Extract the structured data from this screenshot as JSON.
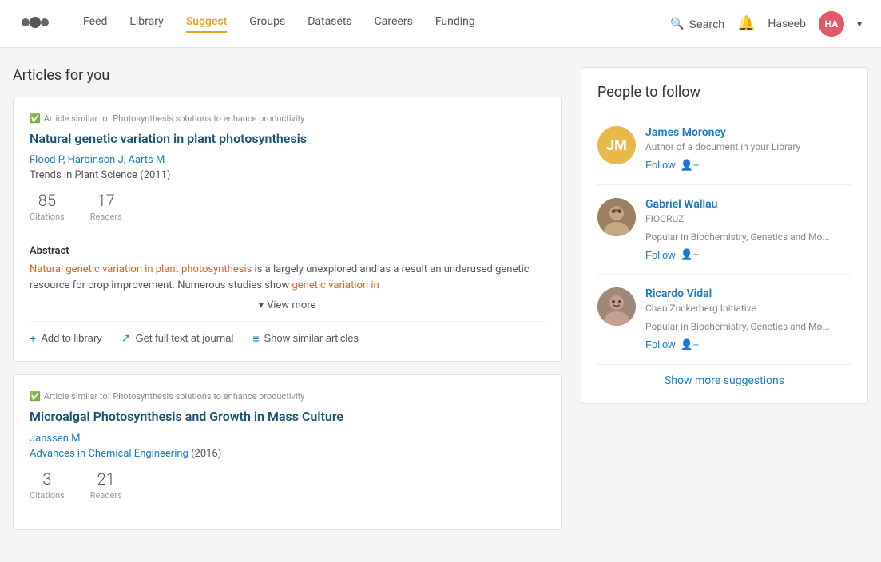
{
  "header": {
    "logo_alt": "Mendeley logo",
    "nav": [
      {
        "label": "Feed",
        "active": false
      },
      {
        "label": "Library",
        "active": false
      },
      {
        "label": "Suggest",
        "active": true
      },
      {
        "label": "Groups",
        "active": false
      },
      {
        "label": "Datasets",
        "active": false
      },
      {
        "label": "Careers",
        "active": false
      },
      {
        "label": "Funding",
        "active": false
      }
    ],
    "search_label": "Search",
    "user_name": "Haseeb",
    "user_initials": "HA"
  },
  "left_section": {
    "title": "Articles for you",
    "articles": [
      {
        "tag_prefix": "Article similar to:",
        "tag_article": "Photosynthesis solutions to enhance productivity",
        "title": "Natural genetic variation in plant photosynthesis",
        "authors": "Flood P, Harbinson J, Aarts M",
        "journal": "Trends in Plant Science (2011)",
        "citations": 85,
        "citations_label": "Citations",
        "readers": 17,
        "readers_label": "Readers",
        "abstract_title": "Abstract",
        "abstract_text": "Natural genetic variation in plant photosynthesis is a largely unexplored and as a result an underused genetic resource for crop improvement. Numerous studies show genetic variation in",
        "abstract_highlighted": [
          "Natural",
          "genetic",
          "variation",
          "in",
          "plant",
          "photosynthesis",
          "in",
          "genetic",
          "variation",
          "in"
        ],
        "view_more": "View more",
        "actions": [
          {
            "label": "Add to library",
            "icon": "+"
          },
          {
            "label": "Get full text at journal",
            "icon": "↗"
          },
          {
            "label": "Show similar articles",
            "icon": "≡"
          }
        ]
      },
      {
        "tag_prefix": "Article similar to:",
        "tag_article": "Photosynthesis solutions to enhance productivity",
        "title": "Microalgal Photosynthesis and Growth in Mass Culture",
        "authors": "Janssen M",
        "journal": "Advances in Chemical Engineering (2016)",
        "citations": 3,
        "citations_label": "Citations",
        "readers": 21,
        "readers_label": "Readers"
      }
    ]
  },
  "right_section": {
    "title": "People to follow",
    "people": [
      {
        "name": "James Moroney",
        "description": "Author of a document in your Library",
        "initials": "JM",
        "avatar_type": "initials",
        "follow_label": "Follow"
      },
      {
        "name": "Gabriel Wallau",
        "org": "FIOCRUZ",
        "description": "Popular in Biochemistry, Genetics and Mo...",
        "avatar_type": "photo",
        "avatar_emoji": "👨",
        "follow_label": "Follow"
      },
      {
        "name": "Ricardo Vidal",
        "org": "Chan Zuckerberg Initiative",
        "description": "Popular in Biochemistry, Genetics and Mo...",
        "avatar_type": "photo",
        "avatar_emoji": "👨",
        "follow_label": "Follow"
      }
    ],
    "show_more": "Show more suggestions"
  }
}
